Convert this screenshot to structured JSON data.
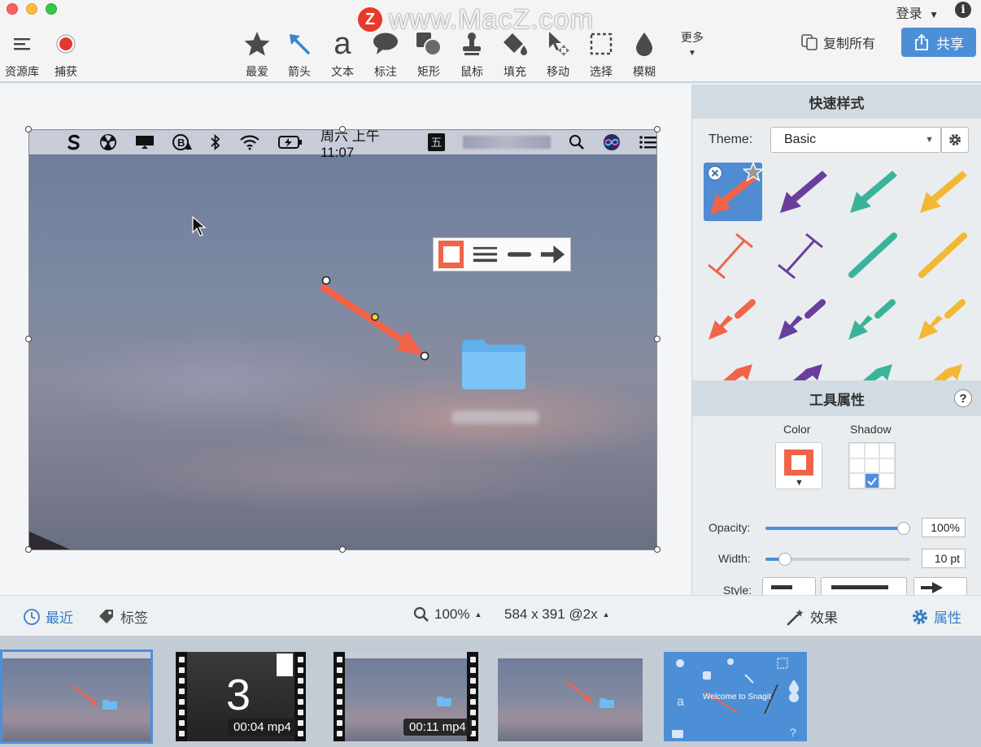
{
  "window": {
    "watermark_text": "www.MacZ.com",
    "watermark_logo": "Z",
    "login_label": "登录",
    "login_caret": "▼",
    "info_glyph": "i"
  },
  "toolbar": {
    "library_label": "资源库",
    "capture_label": "捕获",
    "tools": [
      {
        "label": "最爱",
        "icon": "star-icon"
      },
      {
        "label": "箭头",
        "icon": "arrow-icon"
      },
      {
        "label": "文本",
        "icon": "text-icon"
      },
      {
        "label": "标注",
        "icon": "callout-icon"
      },
      {
        "label": "矩形",
        "icon": "shape-icon"
      },
      {
        "label": "鼠标",
        "icon": "stamp-icon"
      },
      {
        "label": "填充",
        "icon": "fill-icon"
      },
      {
        "label": "移动",
        "icon": "move-icon"
      },
      {
        "label": "选择",
        "icon": "selection-icon"
      },
      {
        "label": "模糊",
        "icon": "blur-icon"
      }
    ],
    "more_label": "更多",
    "copy_all_label": "复制所有",
    "share_label": "共享"
  },
  "capture": {
    "menubar_time": "周六 上午11:07",
    "menubar_input": "五"
  },
  "quick_styles": {
    "title": "快速样式",
    "theme_label": "Theme:",
    "theme_value": "Basic",
    "colors": {
      "red": "#f06449",
      "purple": "#6a3e9c",
      "teal": "#3bb39a",
      "yellow": "#f2b833",
      "selected_bg": "#4f8cd1"
    }
  },
  "tool_properties": {
    "title": "工具属性",
    "help_glyph": "?",
    "color_label": "Color",
    "shadow_label": "Shadow",
    "opacity_label": "Opacity:",
    "opacity_value": "100%",
    "opacity_fraction": 1.0,
    "width_label": "Width:",
    "width_value": "10 pt",
    "width_fraction": 0.1,
    "style_label": "Style:",
    "color_value": "#f06449"
  },
  "statusbar": {
    "recent_label": "最近",
    "tags_label": "标签",
    "zoom_value": "100%",
    "dimensions": "584 x 391 @2x",
    "effects_label": "效果",
    "properties_label": "属性"
  },
  "filmstrip": {
    "thumbs": [
      {
        "kind": "image",
        "selected": true
      },
      {
        "kind": "video",
        "badge": "3",
        "duration": "00:04 mp4"
      },
      {
        "kind": "video",
        "duration": "00:11 mp4"
      },
      {
        "kind": "image"
      },
      {
        "kind": "welcome",
        "caption": "Welcome to Snagit"
      }
    ]
  }
}
